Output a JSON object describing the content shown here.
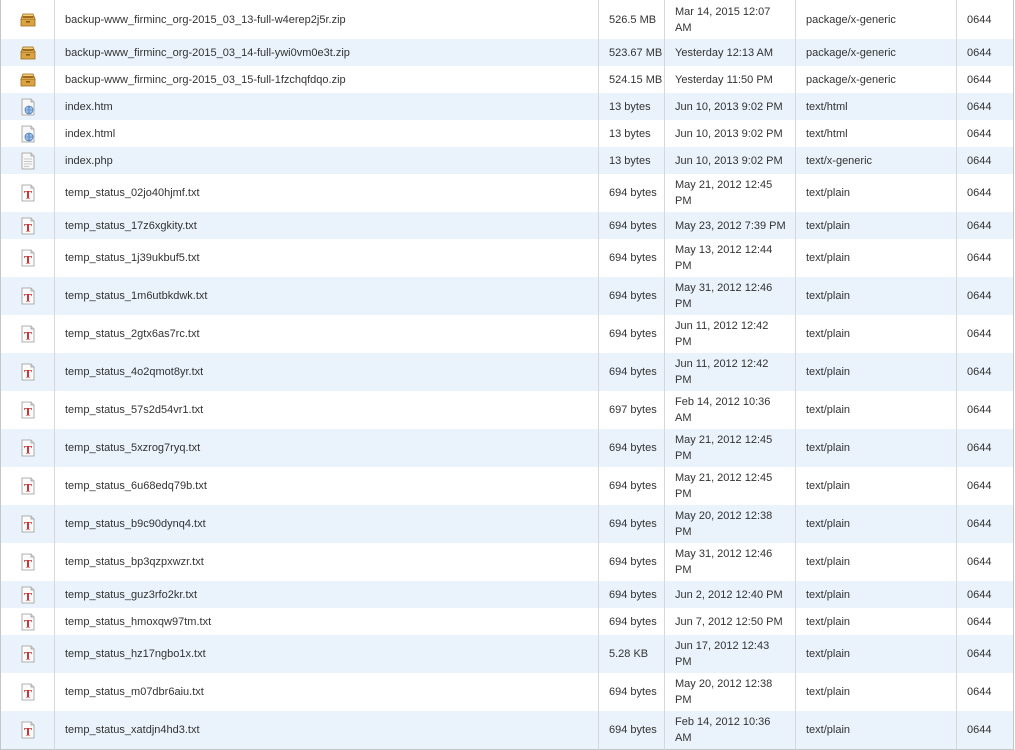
{
  "file_list": {
    "rows": [
      {
        "name": "backup-www_firminc_org-2015_03_13-full-w4erep2j5r.zip",
        "size": "526.5 MB",
        "modified": "Mar 14, 2015 12:07 AM",
        "type": "package/x-generic",
        "perms": "0644",
        "icon": "archive-icon",
        "row_h": 39
      },
      {
        "name": "backup-www_firminc_org-2015_03_14-full-ywi0vm0e3t.zip",
        "size": "523.67 MB",
        "modified": "Yesterday 12:13 AM",
        "type": "package/x-generic",
        "perms": "0644",
        "icon": "archive-icon",
        "row_h": 27
      },
      {
        "name": "backup-www_firminc_org-2015_03_15-full-1fzchqfdqo.zip",
        "size": "524.15 MB",
        "modified": "Yesterday 11:50 PM",
        "type": "package/x-generic",
        "perms": "0644",
        "icon": "archive-icon",
        "row_h": 27
      },
      {
        "name": "index.htm",
        "size": "13 bytes",
        "modified": "Jun 10, 2013 9:02 PM",
        "type": "text/html",
        "perms": "0644",
        "icon": "html-file-icon",
        "row_h": 27
      },
      {
        "name": "index.html",
        "size": "13 bytes",
        "modified": "Jun 10, 2013 9:02 PM",
        "type": "text/html",
        "perms": "0644",
        "icon": "html-file-icon",
        "row_h": 27
      },
      {
        "name": "index.php",
        "size": "13 bytes",
        "modified": "Jun 10, 2013 9:02 PM",
        "type": "text/x-generic",
        "perms": "0644",
        "icon": "generic-file-icon",
        "row_h": 27
      },
      {
        "name": "temp_status_02jo40hjmf.txt",
        "size": "694 bytes",
        "modified": "May 21, 2012 12:45 PM",
        "type": "text/plain",
        "perms": "0644",
        "icon": "text-file-icon",
        "row_h": 38
      },
      {
        "name": "temp_status_17z6xgkity.txt",
        "size": "694 bytes",
        "modified": "May 23, 2012 7:39 PM",
        "type": "text/plain",
        "perms": "0644",
        "icon": "text-file-icon",
        "row_h": 27
      },
      {
        "name": "temp_status_1j39ukbuf5.txt",
        "size": "694 bytes",
        "modified": "May 13, 2012 12:44 PM",
        "type": "text/plain",
        "perms": "0644",
        "icon": "text-file-icon",
        "row_h": 38
      },
      {
        "name": "temp_status_1m6utbkdwk.txt",
        "size": "694 bytes",
        "modified": "May 31, 2012 12:46 PM",
        "type": "text/plain",
        "perms": "0644",
        "icon": "text-file-icon",
        "row_h": 38
      },
      {
        "name": "temp_status_2gtx6as7rc.txt",
        "size": "694 bytes",
        "modified": "Jun 11, 2012 12:42 PM",
        "type": "text/plain",
        "perms": "0644",
        "icon": "text-file-icon",
        "row_h": 38
      },
      {
        "name": "temp_status_4o2qmot8yr.txt",
        "size": "694 bytes",
        "modified": "Jun 11, 2012 12:42 PM",
        "type": "text/plain",
        "perms": "0644",
        "icon": "text-file-icon",
        "row_h": 38
      },
      {
        "name": "temp_status_57s2d54vr1.txt",
        "size": "697 bytes",
        "modified": "Feb 14, 2012 10:36 AM",
        "type": "text/plain",
        "perms": "0644",
        "icon": "text-file-icon",
        "row_h": 38
      },
      {
        "name": "temp_status_5xzrog7ryq.txt",
        "size": "694 bytes",
        "modified": "May 21, 2012 12:45 PM",
        "type": "text/plain",
        "perms": "0644",
        "icon": "text-file-icon",
        "row_h": 38
      },
      {
        "name": "temp_status_6u68edq79b.txt",
        "size": "694 bytes",
        "modified": "May 21, 2012 12:45 PM",
        "type": "text/plain",
        "perms": "0644",
        "icon": "text-file-icon",
        "row_h": 38
      },
      {
        "name": "temp_status_b9c90dynq4.txt",
        "size": "694 bytes",
        "modified": "May 20, 2012 12:38 PM",
        "type": "text/plain",
        "perms": "0644",
        "icon": "text-file-icon",
        "row_h": 38
      },
      {
        "name": "temp_status_bp3qzpxwzr.txt",
        "size": "694 bytes",
        "modified": "May 31, 2012 12:46 PM",
        "type": "text/plain",
        "perms": "0644",
        "icon": "text-file-icon",
        "row_h": 38
      },
      {
        "name": "temp_status_guz3rfo2kr.txt",
        "size": "694 bytes",
        "modified": "Jun 2, 2012 12:40 PM",
        "type": "text/plain",
        "perms": "0644",
        "icon": "text-file-icon",
        "row_h": 27
      },
      {
        "name": "temp_status_hmoxqw97tm.txt",
        "size": "694 bytes",
        "modified": "Jun 7, 2012 12:50 PM",
        "type": "text/plain",
        "perms": "0644",
        "icon": "text-file-icon",
        "row_h": 27
      },
      {
        "name": "temp_status_hz17ngbo1x.txt",
        "size": "5.28 KB",
        "modified": "Jun 17, 2012 12:43 PM",
        "type": "text/plain",
        "perms": "0644",
        "icon": "text-file-icon",
        "row_h": 38
      },
      {
        "name": "temp_status_m07dbr6aiu.txt",
        "size": "694 bytes",
        "modified": "May 20, 2012 12:38 PM",
        "type": "text/plain",
        "perms": "0644",
        "icon": "text-file-icon",
        "row_h": 38
      },
      {
        "name": "temp_status_xatdjn4hd3.txt",
        "size": "694 bytes",
        "modified": "Feb 14, 2012 10:36 AM",
        "type": "text/plain",
        "perms": "0644",
        "icon": "text-file-icon",
        "row_h": 38
      }
    ]
  },
  "colors": {
    "row_alt_bg": "#eaf2fb",
    "border": "#d7d7d7",
    "text": "#333333"
  }
}
